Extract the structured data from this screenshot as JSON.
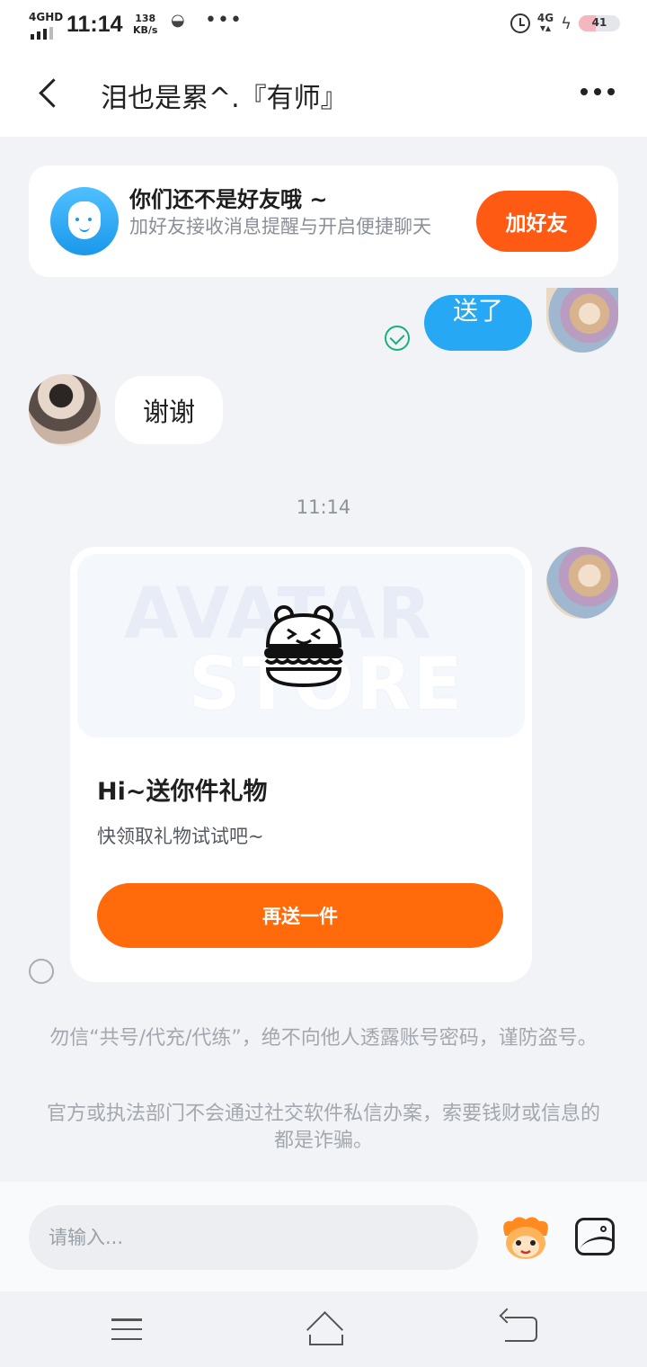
{
  "status_bar": {
    "network": "4GHD",
    "time": "11:14",
    "speed_value": "138",
    "speed_unit": "KB/s",
    "more": "•••",
    "cell": "4G",
    "battery": "41",
    "battery_level": 0.41
  },
  "header": {
    "title": "泪也是累^.『有师』"
  },
  "friend_banner": {
    "title": "你们还不是好友哦 ~",
    "subtitle": "加好友接收消息提醒与开启便捷聊天",
    "add_button": "加好友"
  },
  "messages": {
    "sent_text": "送了",
    "received_text": "谢谢",
    "timestamp": "11:14"
  },
  "gift_card": {
    "watermark_top": "AVATAR",
    "watermark_bottom": "STORE",
    "title": "Hi~送你件礼物",
    "subtitle": "快领取礼物试试吧~",
    "button": "再送一件"
  },
  "notices": {
    "warning_1": "勿信“共号/代充/代练”，绝不向他人透露账号密码，谨防盗号。",
    "warning_2": "官方或执法部门不会通过社交软件私信办案，索要钱财或信息的都是诈骗。"
  },
  "input_bar": {
    "placeholder": "请输入..."
  },
  "colors": {
    "accent_orange": "#ff6a0a",
    "bubble_blue": "#27a8f5",
    "read_green": "#17b27a"
  },
  "icons": {
    "back": "back-arrow-icon",
    "more": "more-icon",
    "wave": "wave-hand-icon",
    "read": "read-check-icon",
    "gift": "burger-icon",
    "emoji": "emoji-icon",
    "image": "image-icon"
  }
}
